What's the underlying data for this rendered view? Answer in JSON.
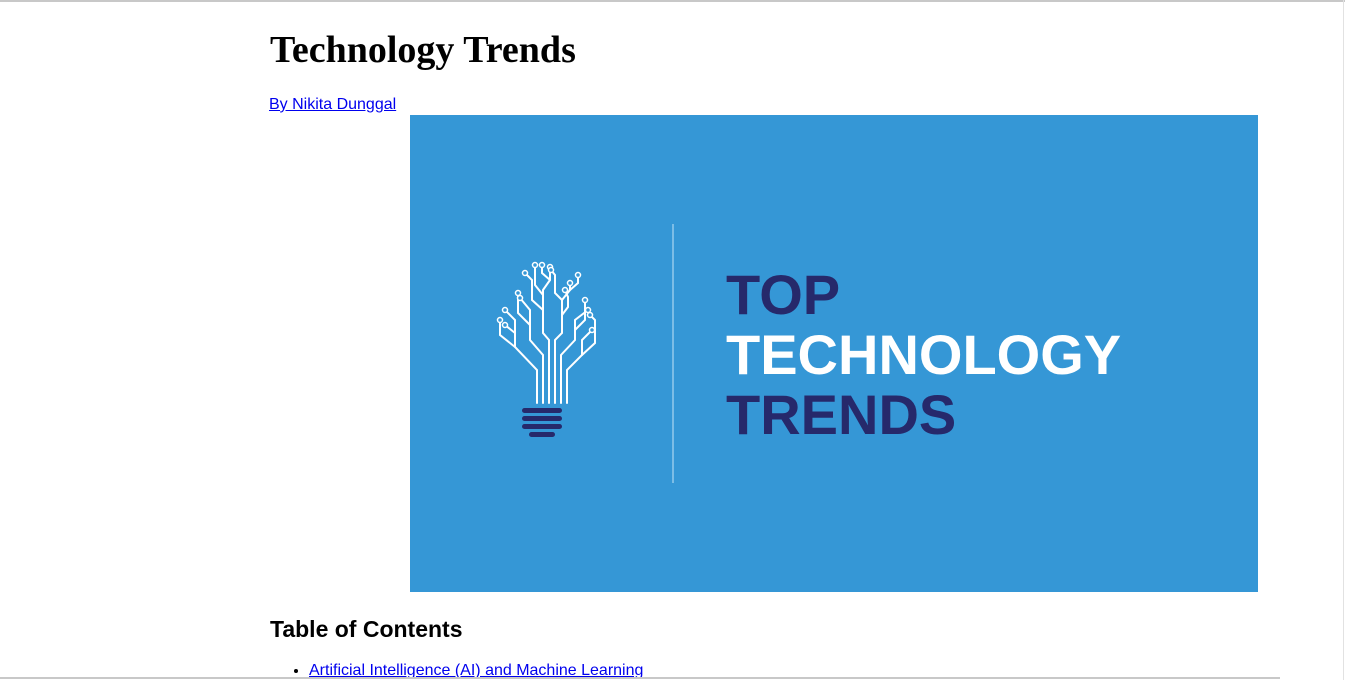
{
  "page": {
    "title": "Technology Trends",
    "author_link": "By Nikita Dunggal"
  },
  "hero": {
    "line1": "TOP",
    "line2": "TECHNOLOGY",
    "line3": "TRENDS",
    "icon": "lightbulb-circuit-icon",
    "colors": {
      "background": "#3597d6",
      "dark_text": "#26296b",
      "light_text": "#ffffff"
    }
  },
  "toc": {
    "title": "Table of Contents",
    "items": [
      {
        "label": "Artificial Intelligence (AI) and Machine Learning"
      }
    ]
  }
}
